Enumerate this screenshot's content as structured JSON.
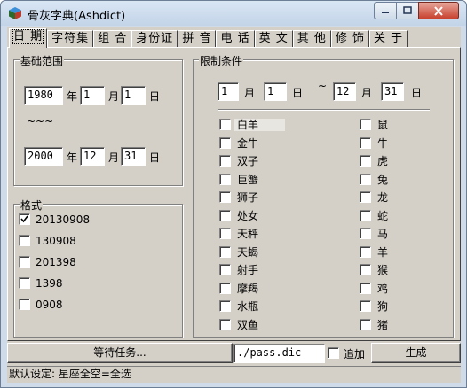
{
  "window": {
    "title": "骨灰字典(Ashdict)"
  },
  "tabs": [
    "日 期",
    "字符集",
    "组 合",
    "身份证",
    "拼 音",
    "电 话",
    "英 文",
    "其 他",
    "修 饰",
    "关 于"
  ],
  "range": {
    "label": "基础范围",
    "start": {
      "year": "1980",
      "month": "1",
      "day": "1"
    },
    "end": {
      "year": "2000",
      "month": "12",
      "day": "31"
    },
    "separator": "~~~",
    "year_unit": "年",
    "month_unit": "月",
    "day_unit": "日"
  },
  "format": {
    "label": "格式",
    "options": [
      {
        "label": "20130908",
        "checked": true
      },
      {
        "label": "130908",
        "checked": false
      },
      {
        "label": "201398",
        "checked": false
      },
      {
        "label": "1398",
        "checked": false
      },
      {
        "label": "0908",
        "checked": false
      }
    ]
  },
  "limit": {
    "label": "限制条件",
    "from": {
      "month": "1",
      "day": "1"
    },
    "to": {
      "month": "12",
      "day": "31"
    },
    "tilde": "~",
    "zodiac": [
      "白羊",
      "金牛",
      "双子",
      "巨蟹",
      "狮子",
      "处女",
      "天秤",
      "天蝎",
      "射手",
      "摩羯",
      "水瓶",
      "双鱼"
    ],
    "animals": [
      "鼠",
      "牛",
      "虎",
      "兔",
      "龙",
      "蛇",
      "马",
      "羊",
      "猴",
      "鸡",
      "狗",
      "猪"
    ]
  },
  "bottom": {
    "task_button": "等待任务...",
    "output_path": "./pass.dic",
    "append_label": "追加",
    "generate_button": "生成"
  },
  "status": "默认设定: 星座全空=全选"
}
